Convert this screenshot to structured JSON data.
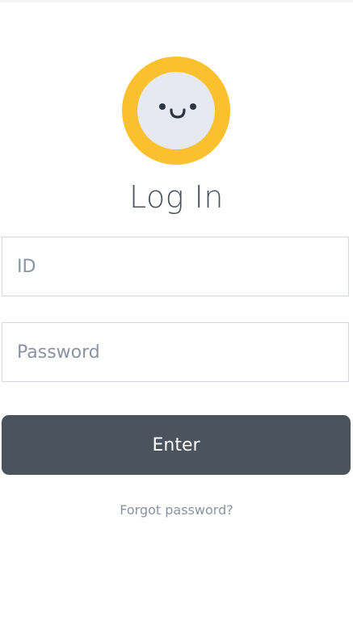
{
  "colors": {
    "avatar_ring": "#fbc02d",
    "avatar_face": "#e6e9f2",
    "title_text": "#4a535e",
    "button_bg": "#4b545d",
    "button_text": "#ffffff",
    "placeholder_text": "#8a93a1",
    "link_text": "#8a93a1"
  },
  "avatar": {
    "icon": "smiley-face-icon"
  },
  "login": {
    "title": "Log In",
    "id_field": {
      "placeholder": "ID",
      "value": ""
    },
    "password_field": {
      "placeholder": "Password",
      "value": ""
    },
    "enter_label": "Enter",
    "forgot_password_label": "Forgot password?"
  }
}
